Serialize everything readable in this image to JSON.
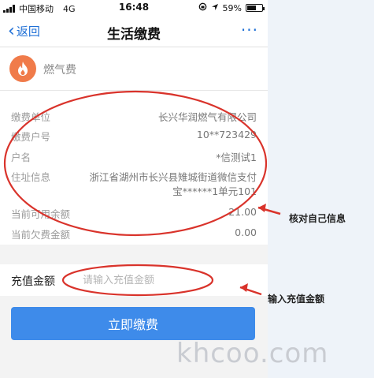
{
  "status_bar": {
    "carrier": "中国移动",
    "network": "4G",
    "time": "16:48",
    "battery": "59%"
  },
  "nav": {
    "back_label": "返回",
    "title": "生活缴费",
    "more": "···"
  },
  "service": {
    "name": "燃气费",
    "icon": "flame-icon",
    "icon_color": "#f07b4a"
  },
  "info_rows": [
    {
      "label": "缴费单位",
      "value": "长兴华润燃气有限公司"
    },
    {
      "label": "缴费户号",
      "value": "10**723429"
    },
    {
      "label": "户名",
      "value": "*信测试1"
    },
    {
      "label": "住址信息",
      "value": "浙江省湖州市长兴县雉城街道微信支付",
      "value_line2": "宝******1单元101"
    },
    {
      "label": "当前可用余额",
      "value": "21.00"
    },
    {
      "label": "当前欠费金额",
      "value": "0.00"
    }
  ],
  "charge": {
    "label": "充值金额",
    "placeholder": "请输入充值金额"
  },
  "pay_button": "立即缴费",
  "annotations": {
    "check_info": "核对自己信息",
    "enter_amount": "输入充值金额",
    "color": "#d9332b"
  },
  "watermark": "khcoo.com"
}
